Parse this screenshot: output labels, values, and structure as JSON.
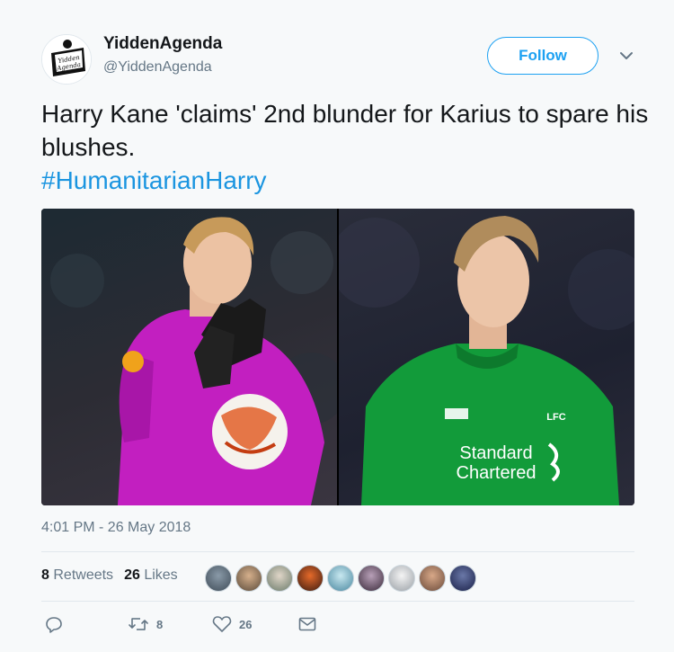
{
  "user": {
    "name": "YiddenAgenda",
    "handle": "@YiddenAgenda",
    "avatar_text": "Yidden Agenda"
  },
  "follow_label": "Follow",
  "tweet": {
    "text": "Harry Kane 'claims' 2nd blunder for Karius to spare his blushes.",
    "hashtag": "#HumanitarianHarry"
  },
  "photos": {
    "right_sponsor_line1": "Standard",
    "right_sponsor_line2": "Chartered",
    "right_crest": "LFC"
  },
  "timestamp": "4:01 PM - 26 May 2018",
  "stats": {
    "retweets_count": "8",
    "retweets_label": "Retweets",
    "likes_count": "26",
    "likes_label": "Likes"
  },
  "actions": {
    "retweet_count": "8",
    "like_count": "26"
  },
  "colors": {
    "accent": "#1da1f2",
    "hashtag": "#1b95e0",
    "secondary_text": "#657786"
  },
  "likers": [
    "avatar-1",
    "avatar-2",
    "avatar-3",
    "avatar-4",
    "avatar-5",
    "avatar-6",
    "avatar-7",
    "avatar-8",
    "avatar-9"
  ]
}
